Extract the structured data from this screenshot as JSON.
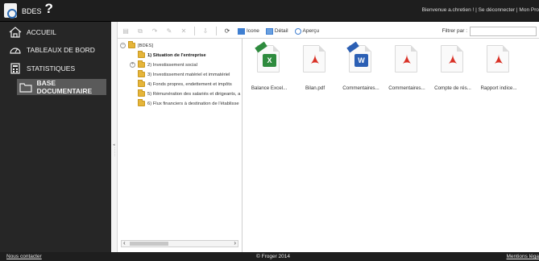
{
  "header": {
    "app_title": "BDES",
    "help_glyph": "?",
    "user_text": "Bienvenue a.chretien ! | Se déconnecter | Mon Pro"
  },
  "sidebar": {
    "items": [
      {
        "label": "ACCUEIL",
        "icon": "home-icon"
      },
      {
        "label": "TABLEAUX DE BORD",
        "icon": "dashboard-gauge-icon"
      },
      {
        "label": "STATISTIQUES",
        "icon": "statistics-calculator-icon"
      },
      {
        "label": "BASE DOCUMENTAIRE",
        "icon": "folder-icon",
        "active": true
      }
    ]
  },
  "toolbar": {
    "view_icon_label": "Icone",
    "view_detail_label": "Détail",
    "view_preview_label": "Aperçu",
    "filter_label": "Filtrer par :",
    "filter_value": ""
  },
  "tree": {
    "root": "[BDES]",
    "nodes": [
      {
        "label": "1) Situation de l'entreprise",
        "selected": true
      },
      {
        "label": "2) Investissement social"
      },
      {
        "label": "3) Investissement matériel et immatériel"
      },
      {
        "label": "4) Fonds propres, endettement et impôts"
      },
      {
        "label": "5) Rémunération des salariés et dirigeants, a"
      },
      {
        "label": "6) Flux financiers à destination de l'établisse"
      }
    ]
  },
  "files": [
    {
      "name": "Balance Excel...",
      "type": "excel",
      "badge": "X"
    },
    {
      "name": "Bilan.pdf",
      "type": "pdf"
    },
    {
      "name": "Commentaires...",
      "type": "word",
      "badge": "W"
    },
    {
      "name": "Commentaires...",
      "type": "pdf"
    },
    {
      "name": "Compte de rés...",
      "type": "pdf"
    },
    {
      "name": "Rapport indice...",
      "type": "pdf"
    }
  ],
  "footer": {
    "contact": "Nous contacter",
    "copyright": "© Froger 2014",
    "mentions": "Mentions léga"
  },
  "colors": {
    "bar": "#1e1e1e",
    "sidebar": "#262626",
    "active_item": "#5a5a5a",
    "excel": "#2e8b3e",
    "word": "#2b5fb4",
    "pdf": "#d93025",
    "folder": "#e5b53a"
  }
}
